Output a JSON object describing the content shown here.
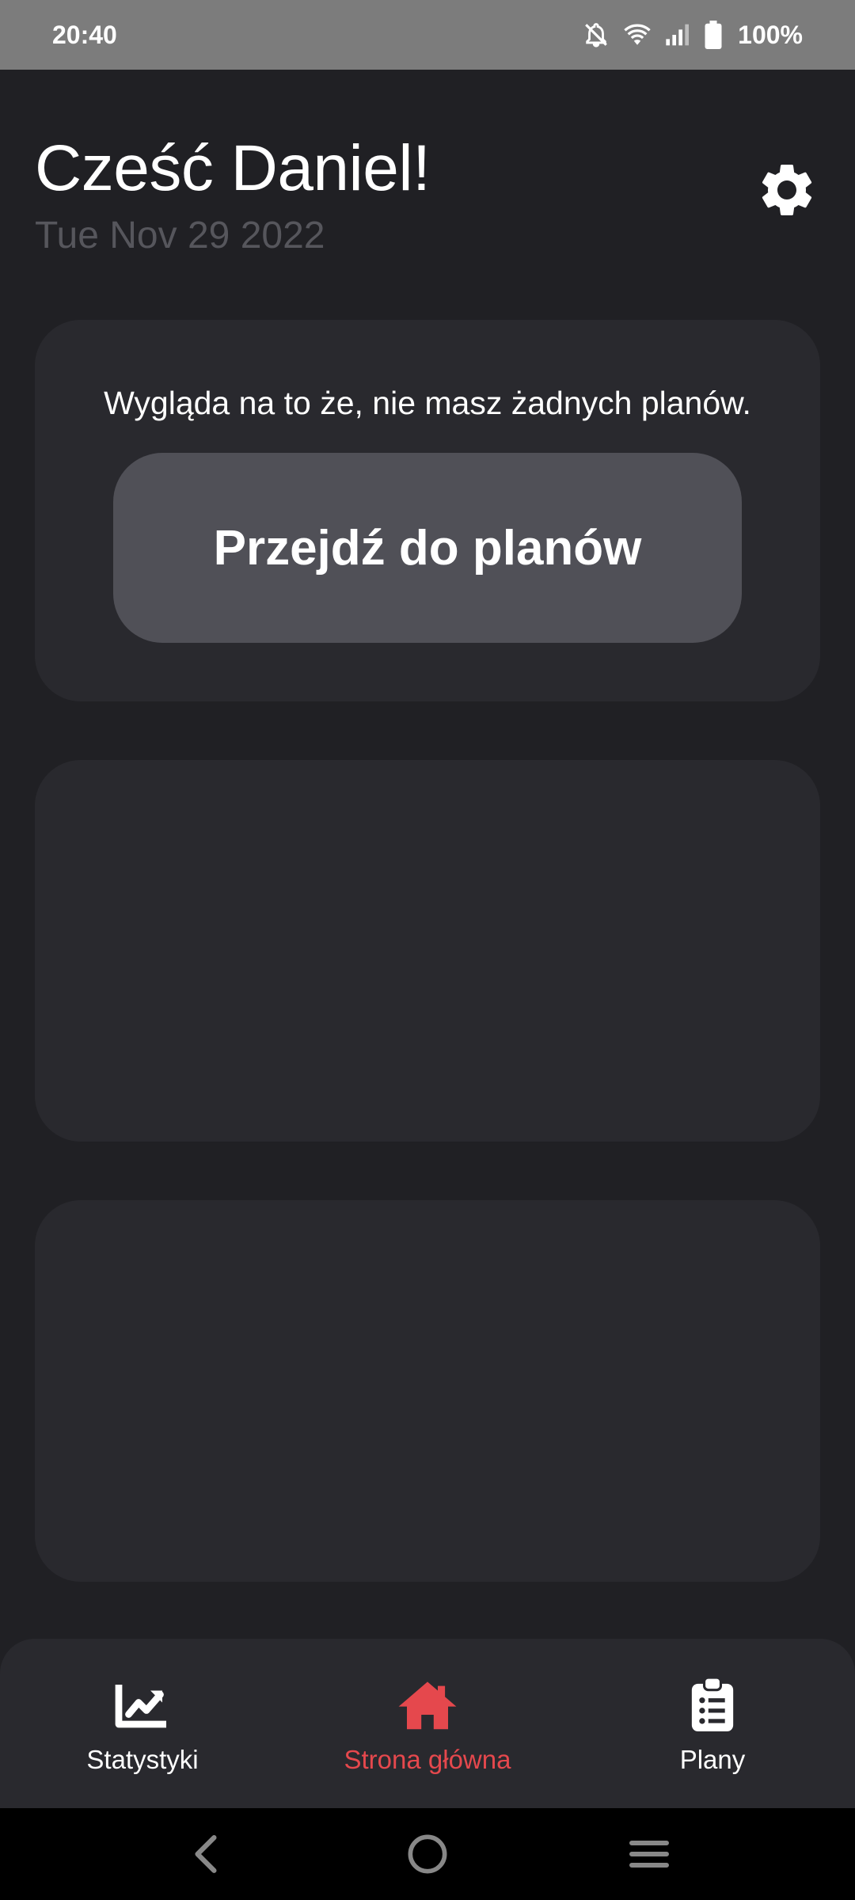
{
  "status_bar": {
    "time": "20:40",
    "battery": "100%",
    "icons": [
      "bell-off-icon",
      "wifi-icon",
      "signal-icon",
      "battery-icon"
    ]
  },
  "header": {
    "greeting": "Cześć Daniel!",
    "date": "Tue Nov 29 2022",
    "settings_icon": "gear-icon"
  },
  "plans_card": {
    "message": "Wygląda na to że, nie masz żadnych planów.",
    "button_label": "Przejdź do planów"
  },
  "bottom_nav": {
    "items": [
      {
        "label": "Statystyki",
        "icon": "chart-icon",
        "active": false
      },
      {
        "label": "Strona główna",
        "icon": "home-icon",
        "active": true
      },
      {
        "label": "Plany",
        "icon": "clipboard-list-icon",
        "active": false
      }
    ]
  },
  "system_nav": {
    "buttons": [
      "back-icon",
      "home-circle-icon",
      "menu-icon"
    ]
  },
  "colors": {
    "background": "#202024",
    "card": "#29292e",
    "button": "#505057",
    "accent": "#e5484d",
    "date_text": "#56565c",
    "status_bar": "#7c7c7c"
  }
}
